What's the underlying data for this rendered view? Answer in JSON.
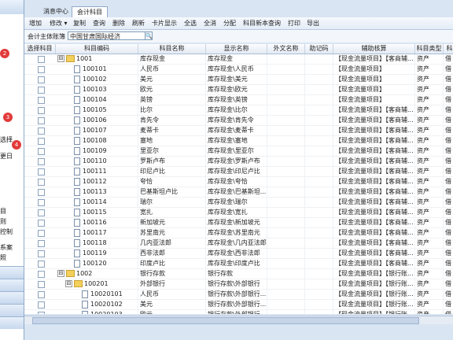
{
  "left_panel": {
    "items": [
      "选择",
      "更日",
      "目",
      "则",
      "控制",
      "系案",
      "照"
    ]
  },
  "tabs": [
    {
      "label": "消息中心",
      "active": false
    },
    {
      "label": "会计科目",
      "active": true
    }
  ],
  "toolbar": {
    "items": [
      "增加",
      "修改 ▾",
      "复制",
      "查询",
      "删除",
      "刷新",
      "卡片显示",
      "全选",
      "全消",
      "分配",
      "科目新本查询",
      "打印",
      "导出"
    ]
  },
  "filter": {
    "label": "会计主体账簿",
    "value": "中国甘肃国际经济",
    "search_icon": "magnifier"
  },
  "table": {
    "columns": [
      "选择科目",
      "科目编码",
      "科目名称",
      "显示名称",
      "外文名称",
      "助记码",
      "辅助核算",
      "科目类型",
      "科目方向"
    ],
    "rows": [
      {
        "code": "1001",
        "name": "库存现金",
        "display": "库存现金",
        "aux": "【现金流量项目】【客商辅...",
        "type": "资产",
        "dir": "借",
        "level": 0,
        "kind": "folder",
        "toggle": "⊟"
      },
      {
        "code": "100101",
        "name": "人民币",
        "display": "库存现金\\人民币",
        "aux": "【现金流量项目】",
        "type": "资产",
        "dir": "借",
        "level": 1,
        "kind": "doc"
      },
      {
        "code": "100102",
        "name": "美元",
        "display": "库存现金\\美元",
        "aux": "【现金流量项目】",
        "type": "资产",
        "dir": "借",
        "level": 1,
        "kind": "doc"
      },
      {
        "code": "100103",
        "name": "欧元",
        "display": "库存现金\\欧元",
        "aux": "【现金流量项目】",
        "type": "资产",
        "dir": "借",
        "level": 1,
        "kind": "doc"
      },
      {
        "code": "100104",
        "name": "英镑",
        "display": "库存现金\\英镑",
        "aux": "【现金流量项目】",
        "type": "资产",
        "dir": "借",
        "level": 1,
        "kind": "doc"
      },
      {
        "code": "100105",
        "name": "比尔",
        "display": "库存现金\\比尔",
        "aux": "【现金流量项目】【客商辅...",
        "type": "资产",
        "dir": "借",
        "level": 1,
        "kind": "doc"
      },
      {
        "code": "100106",
        "name": "肯先令",
        "display": "库存现金\\肯先令",
        "aux": "【现金流量项目】【客商辅...",
        "type": "资产",
        "dir": "借",
        "level": 1,
        "kind": "doc"
      },
      {
        "code": "100107",
        "name": "麦蒂卡",
        "display": "库存现金\\麦蒂卡",
        "aux": "【现金流量项目】【客商辅...",
        "type": "资产",
        "dir": "借",
        "level": 1,
        "kind": "doc"
      },
      {
        "code": "100108",
        "name": "塞地",
        "display": "库存现金\\塞地",
        "aux": "【现金流量项目】【客商辅...",
        "type": "资产",
        "dir": "借",
        "level": 1,
        "kind": "doc"
      },
      {
        "code": "100109",
        "name": "里亚尔",
        "display": "库存现金\\里亚尔",
        "aux": "【现金流量项目】【客商辅...",
        "type": "资产",
        "dir": "借",
        "level": 1,
        "kind": "doc"
      },
      {
        "code": "100110",
        "name": "罗斯卢布",
        "display": "库存现金\\罗斯卢布",
        "aux": "【现金流量项目】【客商辅...",
        "type": "资产",
        "dir": "借",
        "level": 1,
        "kind": "doc"
      },
      {
        "code": "100111",
        "name": "印尼卢比",
        "display": "库存现金\\印尼卢比",
        "aux": "【现金流量项目】【客商辅...",
        "type": "资产",
        "dir": "借",
        "level": 1,
        "kind": "doc"
      },
      {
        "code": "100112",
        "name": "夸恰",
        "display": "库存现金\\夸恰",
        "aux": "【现金流量项目】【客商辅...",
        "type": "资产",
        "dir": "借",
        "level": 1,
        "kind": "doc"
      },
      {
        "code": "100113",
        "name": "巴基斯坦卢比",
        "display": "库存现金\\巴基斯坦...",
        "aux": "【现金流量项目】【客商辅...",
        "type": "资产",
        "dir": "借",
        "level": 1,
        "kind": "doc"
      },
      {
        "code": "100114",
        "name": "瑞尔",
        "display": "库存现金\\瑞尔",
        "aux": "【现金流量项目】【客商辅...",
        "type": "资产",
        "dir": "借",
        "level": 1,
        "kind": "doc"
      },
      {
        "code": "100115",
        "name": "宽扎",
        "display": "库存现金\\宽扎",
        "aux": "【现金流量项目】【客商辅...",
        "type": "资产",
        "dir": "借",
        "level": 1,
        "kind": "doc"
      },
      {
        "code": "100116",
        "name": "新加坡元",
        "display": "库存现金\\新加坡元",
        "aux": "【现金流量项目】【客商辅...",
        "type": "资产",
        "dir": "借",
        "level": 1,
        "kind": "doc"
      },
      {
        "code": "100117",
        "name": "苏里南元",
        "display": "库存现金\\苏里南元",
        "aux": "【现金流量项目】【客商辅...",
        "type": "资产",
        "dir": "借",
        "level": 1,
        "kind": "doc"
      },
      {
        "code": "100118",
        "name": "几内亚法郎",
        "display": "库存现金\\几内亚法郎",
        "aux": "【现金流量项目】【客商辅...",
        "type": "资产",
        "dir": "借",
        "level": 1,
        "kind": "doc"
      },
      {
        "code": "100119",
        "name": "西非法郎",
        "display": "库存现金\\西非法郎",
        "aux": "【现金流量项目】【客商辅...",
        "type": "资产",
        "dir": "借",
        "level": 1,
        "kind": "doc"
      },
      {
        "code": "100120",
        "name": "印度卢比",
        "display": "库存现金\\印度卢比",
        "aux": "【现金流量项目】【客商辅...",
        "type": "资产",
        "dir": "借",
        "level": 1,
        "kind": "doc"
      },
      {
        "code": "1002",
        "name": "银行存款",
        "display": "银行存款",
        "aux": "【现金流量项目】【银行账...",
        "type": "资产",
        "dir": "借",
        "level": 0,
        "kind": "folder",
        "toggle": "⊟"
      },
      {
        "code": "100201",
        "name": "外部银行",
        "display": "银行存款\\外部银行",
        "aux": "【现金流量项目】【银行账...",
        "type": "资产",
        "dir": "借",
        "level": 1,
        "kind": "folder",
        "toggle": "⊟"
      },
      {
        "code": "10020101",
        "name": "人民币",
        "display": "银行存款\\外部银行...",
        "aux": "【现金流量项目】【银行账...",
        "type": "资产",
        "dir": "借",
        "level": 2,
        "kind": "doc"
      },
      {
        "code": "10020102",
        "name": "美元",
        "display": "银行存款\\外部银行...",
        "aux": "【现金流量项目】【银行账...",
        "type": "资产",
        "dir": "借",
        "level": 2,
        "kind": "doc"
      },
      {
        "code": "10020103",
        "name": "欧元",
        "display": "银行存款\\外部银行...",
        "aux": "【现金流量项目】【银行账...",
        "type": "资产",
        "dir": "借",
        "level": 2,
        "kind": "doc"
      },
      {
        "code": "10020104",
        "name": "英镑",
        "display": "银行存款\\外部银行...",
        "aux": "【现金流量项目】【银行账...",
        "type": "资产",
        "dir": "借",
        "level": 2,
        "kind": "doc"
      }
    ]
  },
  "annotations": [
    "2",
    "3",
    "4"
  ],
  "colors": {
    "accent": "#e23b3b",
    "header": "#d9e5f3",
    "folder": "#f3cf5b"
  }
}
